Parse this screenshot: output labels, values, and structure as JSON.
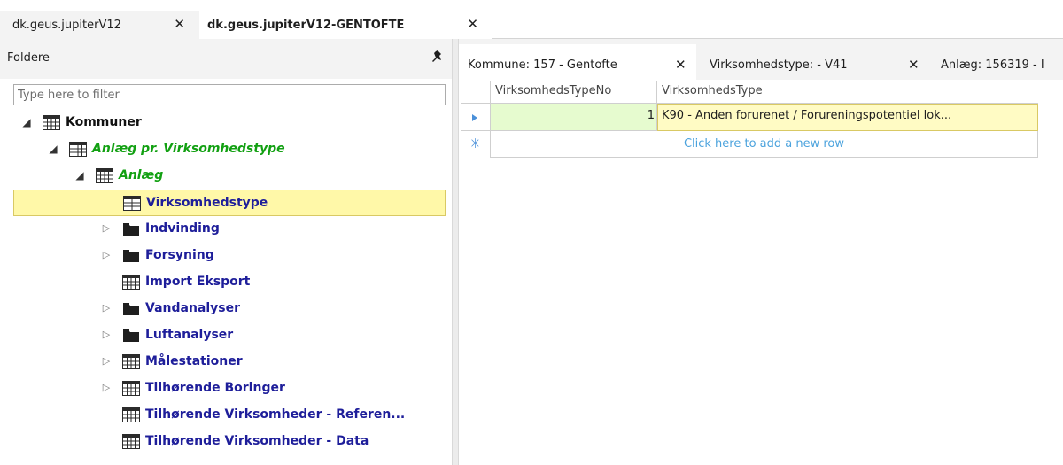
{
  "doc_tabs": [
    {
      "label": "dk.geus.jupiterV12",
      "close": "✕"
    },
    {
      "label": "dk.geus.jupiterV12-GENTOFTE",
      "close": "✕"
    }
  ],
  "left_panel": {
    "title": "Foldere",
    "filter_placeholder": "Type here to filter",
    "tree": [
      {
        "label": "Kommuner",
        "caret": "◢",
        "icon": "table-icon"
      },
      {
        "label": "Anlæg pr. Virksomhedstype",
        "caret": "◢",
        "icon": "table-icon"
      },
      {
        "label": "Anlæg",
        "caret": "◢",
        "icon": "table-icon"
      },
      {
        "label": "Virksomhedstype",
        "caret": "",
        "icon": "table-icon",
        "selected": true
      },
      {
        "label": "Indvinding",
        "caret": "▷",
        "icon": "folder-icon"
      },
      {
        "label": "Forsyning",
        "caret": "▷",
        "icon": "folder-icon"
      },
      {
        "label": "Import Eksport",
        "caret": "",
        "icon": "table-icon"
      },
      {
        "label": "Vandanalyser",
        "caret": "▷",
        "icon": "folder-icon"
      },
      {
        "label": "Luftanalyser",
        "caret": "▷",
        "icon": "folder-icon"
      },
      {
        "label": "Målestationer",
        "caret": "▷",
        "icon": "table-icon"
      },
      {
        "label": "Tilhørende Boringer",
        "caret": "▷",
        "icon": "table-icon"
      },
      {
        "label": "Tilhørende Virksomheder - Referen...",
        "caret": "",
        "icon": "table-icon"
      },
      {
        "label": "Tilhørende Virksomheder - Data",
        "caret": "",
        "icon": "table-icon"
      }
    ]
  },
  "right_panel": {
    "tabs": [
      {
        "label": "Kommune: 157 - Gentofte",
        "close": "✕"
      },
      {
        "label": "Virksomhedstype: - V41",
        "close": "✕"
      },
      {
        "label": "Anlæg: 156319 - I",
        "close": ""
      }
    ],
    "grid": {
      "columns": [
        "VirksomhedsTypeNo",
        "VirksomhedsType"
      ],
      "rows": [
        {
          "no": "1",
          "type": "K90 - Anden forurenet / Forureningspotentiel lok..."
        }
      ],
      "new_row_text": "Click here to add a new row"
    }
  },
  "colors": {
    "selected_row": "#fff8a8",
    "green_label": "#12a012",
    "blue_label": "#1e1e9a",
    "grid_highlight": "#e6fbcf",
    "grid_selected": "#fffbc4",
    "new_row_text": "#4ca3dd"
  }
}
